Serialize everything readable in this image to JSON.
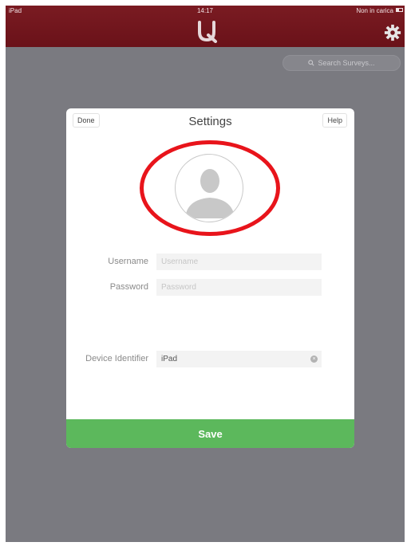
{
  "status_bar": {
    "left": "iPad",
    "time": "14:17",
    "right": "Non in carica"
  },
  "header": {
    "logo_icon": "logo-icon",
    "settings_icon": "gear-icon"
  },
  "search": {
    "placeholder": "Search Surveys..."
  },
  "settings_modal": {
    "title": "Settings",
    "done_label": "Done",
    "help_label": "Help",
    "avatar_icon": "avatar-icon",
    "username_label": "Username",
    "username_placeholder": "Username",
    "password_label": "Password",
    "password_placeholder": "Password",
    "device_label": "Device Identifier",
    "device_value": "iPad",
    "save_label": "Save"
  },
  "colors": {
    "header": "#6e151c",
    "save": "#5cb85c",
    "highlight": "#e8141b",
    "backdrop": "#7a7a80"
  }
}
